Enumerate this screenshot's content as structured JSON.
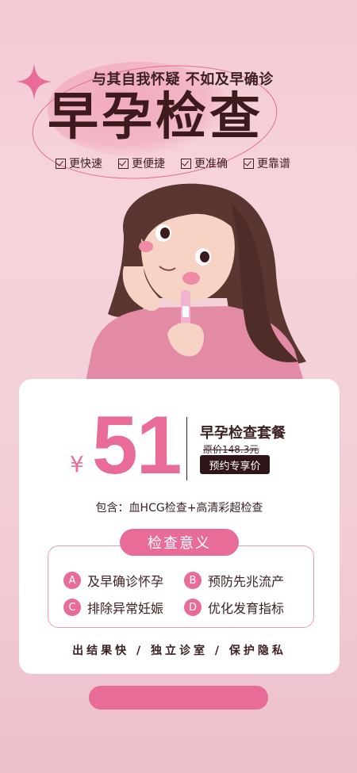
{
  "header": {
    "tagline": "与其自我怀疑 不如及早确诊",
    "title": "早孕检查",
    "features": [
      "更快速",
      "更便捷",
      "更准确",
      "更靠谱"
    ]
  },
  "offer": {
    "currency": "¥",
    "price": "51",
    "package_name": "早孕检查套餐",
    "original_price": "原价148.3元",
    "book_label": "预约专享价",
    "includes": "包含：血HCG检查+高清彩超检查"
  },
  "meaning": {
    "title": "检查意义",
    "items": [
      {
        "letter": "A",
        "text": "及早确诊怀孕"
      },
      {
        "letter": "B",
        "text": "预防先兆流产"
      },
      {
        "letter": "C",
        "text": "排除异常妊娠"
      },
      {
        "letter": "D",
        "text": "优化发育指标"
      }
    ]
  },
  "footer": {
    "benefits": "出结果快 / 独立诊室 / 保护隐私"
  },
  "colors": {
    "accent": "#e86b98",
    "dark": "#3b1f22"
  }
}
